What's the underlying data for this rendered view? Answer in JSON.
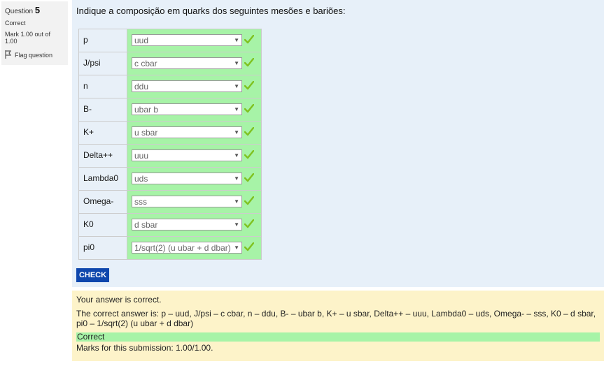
{
  "info": {
    "question_label": "Question",
    "question_number": "5",
    "state": "Correct",
    "grade": "Mark 1.00 out of 1.00",
    "flag_label": "Flag question"
  },
  "question": {
    "text": "Indique a composição em quarks dos seguintes mesões e bariões:",
    "rows": [
      {
        "label": "p",
        "selected": "uud"
      },
      {
        "label": "J/psi",
        "selected": "c cbar"
      },
      {
        "label": "n",
        "selected": "ddu"
      },
      {
        "label": "B-",
        "selected": "ubar b"
      },
      {
        "label": "K+",
        "selected": "u sbar"
      },
      {
        "label": "Delta++",
        "selected": "uuu"
      },
      {
        "label": "Lambda0",
        "selected": "uds"
      },
      {
        "label": "Omega-",
        "selected": "sss"
      },
      {
        "label": "K0",
        "selected": "d sbar"
      },
      {
        "label": "pi0",
        "selected": "1/sqrt(2) (u ubar + d dbar)"
      }
    ],
    "check_label": "CHECK"
  },
  "feedback": {
    "specific": "Your answer is correct.",
    "right_answer": "The correct answer is: p – uud, J/psi – c cbar, n – ddu, B- – ubar b, K+ – u sbar, Delta++ – uuu, Lambda0 – uds, Omega- – sss, K0 – d sbar, pi0 – 1/sqrt(2) (u ubar + d dbar)",
    "status": "Correct",
    "marks": "Marks for this submission: 1.00/1.00."
  },
  "colors": {
    "correct_green": "#a7f3a7",
    "tick_green": "#7fc21f",
    "check_button": "#0f47ad",
    "formulation_bg": "#e7f0f9",
    "feedback_bg": "#fdf3c9"
  }
}
